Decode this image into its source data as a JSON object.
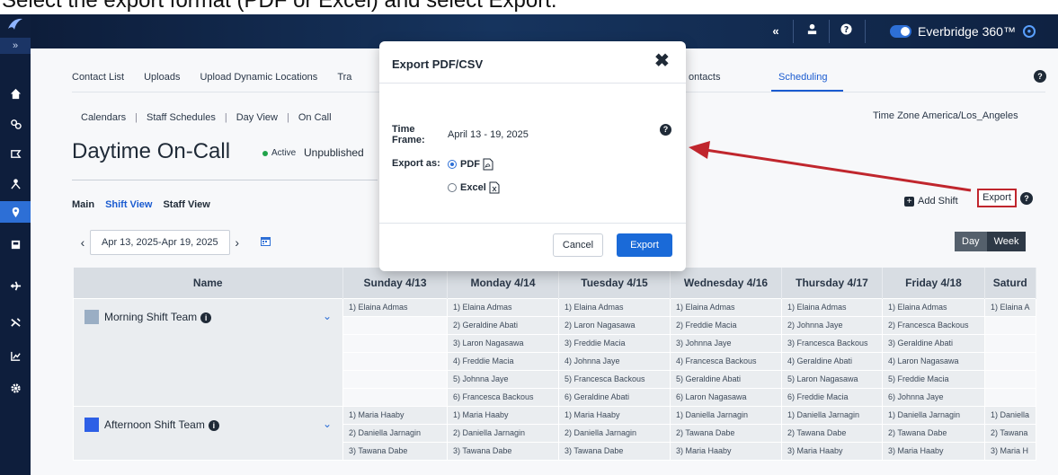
{
  "caption": "Select the export format (PDF or Excel) and select Export.",
  "brand": {
    "name": "Everbridge 360™"
  },
  "tabs": [
    "Contact List",
    "Uploads",
    "Upload Dynamic Locations",
    "Tra",
    "ontacts"
  ],
  "scheduling_tab": "Scheduling",
  "subnav": {
    "calendars": "Calendars",
    "staff_schedules": "Staff Schedules",
    "day_view": "Day View",
    "on_call": "On Call"
  },
  "timezone": "Time Zone America/Los_Angeles",
  "page_title": "Daytime On-Call",
  "status": {
    "active": "Active",
    "unpublished": "Unpublished"
  },
  "views": {
    "main": "Main",
    "shift_view": "Shift View",
    "staff_view": "Staff View"
  },
  "actions": {
    "add_shift": "Add Shift",
    "export": "Export"
  },
  "date_range": "Apr 13, 2025-Apr 19, 2025",
  "day_week": {
    "day": "Day",
    "week": "Week"
  },
  "table": {
    "headers": [
      "Name",
      "Sunday 4/13",
      "Monday 4/14",
      "Tuesday 4/15",
      "Wednesday 4/16",
      "Thursday 4/17",
      "Friday 4/18",
      "Saturd"
    ],
    "teams": [
      {
        "name": "Morning Shift Team",
        "color": "#9aaec4",
        "rows": [
          [
            "1) Elaina Admas",
            "1) Elaina Admas",
            "1) Elaina Admas",
            "1) Elaina Admas",
            "1) Elaina Admas",
            "1) Elaina Admas",
            "1) Elaina A"
          ],
          [
            "",
            "2) Geraldine Abati",
            "2) Laron Nagasawa",
            "2) Freddie Macia",
            "2) Johnna Jaye",
            "2) Francesca Backous",
            ""
          ],
          [
            "",
            "3) Laron Nagasawa",
            "3) Freddie Macia",
            "3) Johnna Jaye",
            "3) Francesca Backous",
            "3) Geraldine Abati",
            ""
          ],
          [
            "",
            "4) Freddie Macia",
            "4) Johnna Jaye",
            "4) Francesca Backous",
            "4) Geraldine Abati",
            "4) Laron Nagasawa",
            ""
          ],
          [
            "",
            "5) Johnna Jaye",
            "5) Francesca Backous",
            "5) Geraldine Abati",
            "5) Laron Nagasawa",
            "5) Freddie Macia",
            ""
          ],
          [
            "",
            "6) Francesca Backous",
            "6) Geraldine Abati",
            "6) Laron Nagasawa",
            "6) Freddie Macia",
            "6) Johnna Jaye",
            ""
          ]
        ]
      },
      {
        "name": "Afternoon Shift Team",
        "color": "#2d5fe6",
        "rows": [
          [
            "1) Maria Haaby",
            "1) Maria Haaby",
            "1) Maria Haaby",
            "1) Daniella Jarnagin",
            "1) Daniella Jarnagin",
            "1) Daniella Jarnagin",
            "1) Daniella"
          ],
          [
            "2) Daniella Jarnagin",
            "2) Daniella Jarnagin",
            "2) Daniella Jarnagin",
            "2) Tawana Dabe",
            "2) Tawana Dabe",
            "2) Tawana Dabe",
            "2) Tawana"
          ],
          [
            "3) Tawana Dabe",
            "3) Tawana Dabe",
            "3) Tawana Dabe",
            "3) Maria Haaby",
            "3) Maria Haaby",
            "3) Maria Haaby",
            "3) Maria H"
          ]
        ]
      }
    ]
  },
  "modal": {
    "title": "Export PDF/CSV",
    "time_frame_label": "Time Frame:",
    "time_frame_value": "April 13 - 19, 2025",
    "export_as_label": "Export as:",
    "option_pdf": "PDF",
    "option_excel": "Excel",
    "selected": "PDF",
    "cancel": "Cancel",
    "export": "Export"
  },
  "colors": {
    "accent": "#1a6ad8",
    "annotation": "#c0262d",
    "topbar": "#0d1d3a"
  }
}
